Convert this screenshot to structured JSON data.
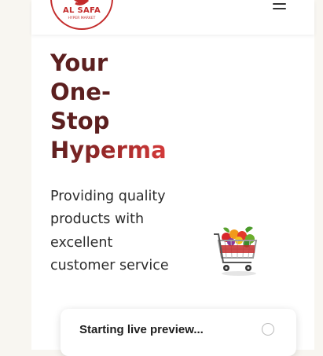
{
  "header": {
    "logo": {
      "name": "AL SAFA",
      "tagline": "HYPER MARKET",
      "brand_color": "#c32b2b",
      "icon": "al-safa-logo"
    },
    "menu_icon": "hamburger-menu-icon"
  },
  "hero": {
    "title_lines": [
      "Your",
      "One-",
      "Stop",
      "Hypermar"
    ],
    "title_color": "#5c1f1f",
    "title_accent": "#d43a3a",
    "description": "Providing quality products with excellent customer service",
    "image_icon": "shopping-cart-with-groceries"
  },
  "toast": {
    "message": "Starting live preview...",
    "icon": "loading-spinner-icon"
  }
}
